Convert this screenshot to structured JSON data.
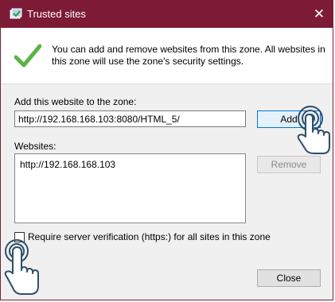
{
  "window": {
    "title": "Trusted sites",
    "close_glyph": "✕",
    "titlebar_color": "#7d1a35"
  },
  "info": {
    "icon": "green-check-icon",
    "text": "You can add and remove websites from this zone. All websites in this zone will use the zone's security settings."
  },
  "add_section": {
    "label": "Add this website to the zone:",
    "input_value": "http://192.168.168.103:8080/HTML_5/",
    "add_button": "Add"
  },
  "websites": {
    "label": "Websites:",
    "items": [
      "http://192.168.168.103"
    ],
    "remove_button": "Remove"
  },
  "options": {
    "require_server_verification_label": "Require server verification (https:) for all sites in this zone",
    "require_server_verification_checked": false
  },
  "footer": {
    "close_button": "Close"
  }
}
